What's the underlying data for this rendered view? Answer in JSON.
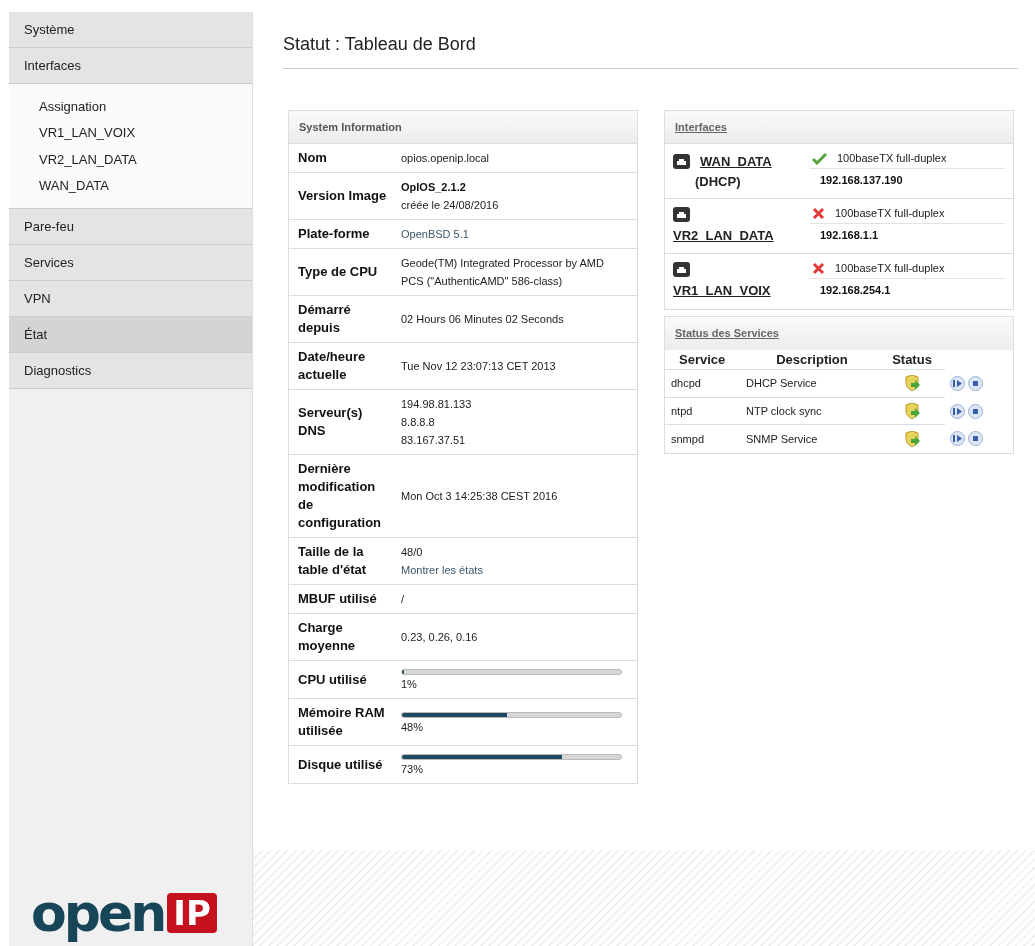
{
  "sidebar": {
    "items": [
      {
        "label": "Système",
        "selected": false
      },
      {
        "label": "Interfaces",
        "selected": false,
        "expanded": true,
        "children": [
          {
            "label": "Assignation"
          },
          {
            "label": "VR1_LAN_VOIX"
          },
          {
            "label": "VR2_LAN_DATA"
          },
          {
            "label": "WAN_DATA"
          }
        ]
      },
      {
        "label": "Pare-feu",
        "selected": false
      },
      {
        "label": "Services",
        "selected": false
      },
      {
        "label": "VPN",
        "selected": false
      },
      {
        "label": "État",
        "selected": true
      },
      {
        "label": "Diagnostics",
        "selected": false
      }
    ],
    "logo": {
      "word": "open",
      "badge": "IP"
    }
  },
  "page_title": "Statut : Tableau de Bord",
  "system_info": {
    "title": "System Information",
    "rows": [
      {
        "label": "Nom",
        "kind": "text",
        "lines": [
          {
            "text": "opios.openip.local",
            "kind": "plain"
          }
        ]
      },
      {
        "label": "Version Image",
        "kind": "text",
        "lines": [
          {
            "text": "OpIOS_2.1.2",
            "kind": "strong"
          },
          {
            "text": "créée le 24/08/2016",
            "kind": "plain"
          }
        ]
      },
      {
        "label": "Plate-forme",
        "kind": "text",
        "lines": [
          {
            "text": "OpenBSD 5.1",
            "kind": "link"
          }
        ]
      },
      {
        "label": "Type de CPU",
        "kind": "text",
        "lines": [
          {
            "text": "Geode(TM) Integrated Processor by AMD PCS (\"AuthenticAMD\" 586-class)",
            "kind": "plain"
          }
        ]
      },
      {
        "label": "Démarré depuis",
        "kind": "text",
        "lines": [
          {
            "text": "02 Hours 06 Minutes 02 Seconds",
            "kind": "plain"
          }
        ]
      },
      {
        "label": "Date/heure actuelle",
        "kind": "text",
        "lines": [
          {
            "text": "Tue Nov 12 23:07:13 CET 2013",
            "kind": "plain"
          }
        ]
      },
      {
        "label": "Serveur(s) DNS",
        "kind": "text",
        "lines": [
          {
            "text": "194.98.81.133",
            "kind": "plain"
          },
          {
            "text": "8.8.8.8",
            "kind": "plain"
          },
          {
            "text": "83.167.37.51",
            "kind": "plain"
          }
        ]
      },
      {
        "label": "Dernière modification de configuration",
        "kind": "text",
        "lines": [
          {
            "text": "Mon Oct 3 14:25:38 CEST 2016",
            "kind": "plain"
          }
        ]
      },
      {
        "label": "Taille de la table d'état",
        "kind": "text",
        "lines": [
          {
            "text": "48/0",
            "kind": "plain"
          },
          {
            "text": "Montrer les états",
            "kind": "link"
          }
        ]
      },
      {
        "label": "MBUF utilisé",
        "kind": "text",
        "lines": [
          {
            "text": "/",
            "kind": "plain"
          }
        ]
      },
      {
        "label": "Charge moyenne",
        "kind": "text",
        "lines": [
          {
            "text": "0.23, 0.26, 0.16",
            "kind": "plain"
          }
        ]
      },
      {
        "label": "CPU utilisé",
        "kind": "meter",
        "level": 0.01,
        "reading": "1%"
      },
      {
        "label": "Mémoire RAM utilisée",
        "kind": "meter",
        "level": 0.48,
        "reading": "48%"
      },
      {
        "label": "Disque utilisé",
        "kind": "meter",
        "level": 0.73,
        "reading": "73%"
      }
    ]
  },
  "interfaces": {
    "title": "Interfaces",
    "items": [
      {
        "name": "WAN_DATA",
        "mode": "(DHCP)",
        "up": true,
        "media": "100baseTX full-duplex",
        "address": "192.168.137.190"
      },
      {
        "name": "VR2_LAN_DATA",
        "up": false,
        "media": "100baseTX full-duplex",
        "address": "192.168.1.1"
      },
      {
        "name": "VR1_LAN_VOIX",
        "up": false,
        "media": "100baseTX full-duplex",
        "address": "192.168.254.1"
      }
    ]
  },
  "services": {
    "title": "Status des Services",
    "columns": [
      "Service",
      "Description",
      "Status"
    ],
    "rows": [
      {
        "service": "dhcpd",
        "description": "DHCP Service",
        "running": true
      },
      {
        "service": "ntpd",
        "description": "NTP clock sync",
        "running": true
      },
      {
        "service": "snmpd",
        "description": "SNMP Service",
        "running": true
      }
    ]
  }
}
